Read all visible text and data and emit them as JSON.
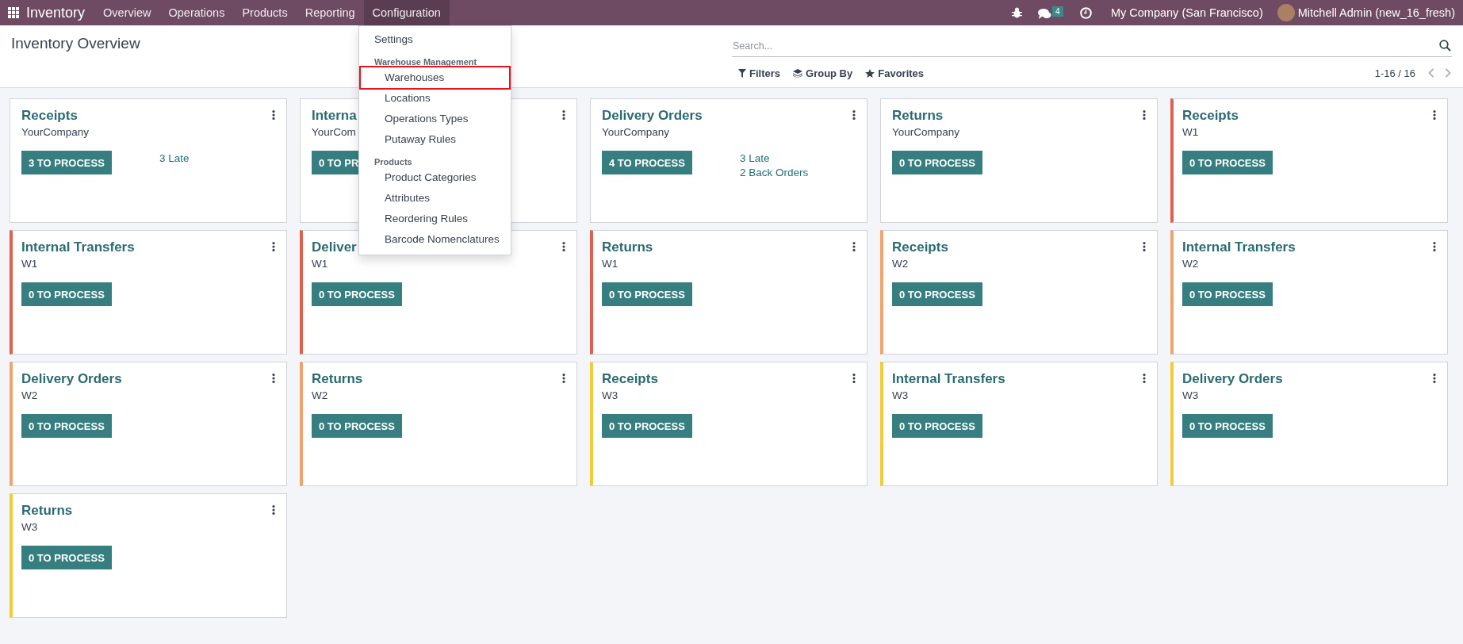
{
  "navbar": {
    "app_name": "Inventory",
    "menus": [
      {
        "label": "Overview",
        "selected": false
      },
      {
        "label": "Operations",
        "selected": false
      },
      {
        "label": "Products",
        "selected": false
      },
      {
        "label": "Reporting",
        "selected": false
      },
      {
        "label": "Configuration",
        "selected": true
      }
    ],
    "messages_badge": "4",
    "company": "My Company (San Francisco)",
    "user": "Mitchell Admin (new_16_fresh)"
  },
  "control_panel": {
    "title": "Inventory Overview",
    "search": {
      "placeholder": "Search..."
    },
    "filters": [
      {
        "kind": "filter",
        "label": "Filters"
      },
      {
        "kind": "group",
        "label": "Group By"
      },
      {
        "kind": "favorite",
        "label": "Favorites"
      }
    ],
    "pager": "1-16 / 16"
  },
  "cards": [
    {
      "title": "Receipts",
      "subtitle": "YourCompany",
      "button": "3 TO PROCESS",
      "links": [
        "3 Late"
      ]
    },
    {
      "title": "Interna",
      "subtitle": "YourCom",
      "button": "0 TO PR"
    },
    {
      "title": "Delivery Orders",
      "subtitle": "YourCompany",
      "button": "4 TO PROCESS",
      "links": [
        "3 Late",
        "2 Back Orders"
      ]
    },
    {
      "title": "Returns",
      "subtitle": "YourCompany",
      "button": "0 TO PROCESS"
    },
    {
      "title": "Receipts",
      "subtitle": "W1",
      "button": "0 TO PROCESS",
      "color": "#e0604f"
    },
    {
      "title": "Internal Transfers",
      "subtitle": "W1",
      "button": "0 TO PROCESS",
      "color": "#e0604f"
    },
    {
      "title": "Deliver",
      "subtitle": "W1",
      "button": "0 TO PROCESS",
      "color": "#e0604f"
    },
    {
      "title": "Returns",
      "subtitle": "W1",
      "button": "0 TO PROCESS",
      "color": "#e0604f"
    },
    {
      "title": "Receipts",
      "subtitle": "W2",
      "button": "0 TO PROCESS",
      "color": "#eda46f"
    },
    {
      "title": "Internal Transfers",
      "subtitle": "W2",
      "button": "0 TO PROCESS",
      "color": "#eda46f"
    },
    {
      "title": "Delivery Orders",
      "subtitle": "W2",
      "button": "0 TO PROCESS",
      "color": "#eda46f"
    },
    {
      "title": "Returns",
      "subtitle": "W2",
      "button": "0 TO PROCESS",
      "color": "#eda46f"
    },
    {
      "title": "Receipts",
      "subtitle": "W3",
      "button": "0 TO PROCESS",
      "color": "#f3cb3a"
    },
    {
      "title": "Internal Transfers",
      "subtitle": "W3",
      "button": "0 TO PROCESS",
      "color": "#f3cb3a"
    },
    {
      "title": "Delivery Orders",
      "subtitle": "W3",
      "button": "0 TO PROCESS",
      "color": "#f3cb3a"
    },
    {
      "title": "Returns",
      "subtitle": "W3",
      "button": "0 TO PROCESS",
      "color": "#f3cb3a"
    }
  ],
  "dropdown": {
    "items": [
      {
        "kind": "item",
        "label": "Settings",
        "highlighted": false
      },
      {
        "kind": "header",
        "label": "Warehouse Management"
      },
      {
        "kind": "subitem",
        "label": "Warehouses",
        "highlighted": true
      },
      {
        "kind": "subitem",
        "label": "Locations",
        "highlighted": false
      },
      {
        "kind": "subitem",
        "label": "Operations Types",
        "highlighted": false
      },
      {
        "kind": "subitem",
        "label": "Putaway Rules",
        "highlighted": false
      },
      {
        "kind": "header",
        "label": "Products"
      },
      {
        "kind": "subitem",
        "label": "Product Categories",
        "highlighted": false
      },
      {
        "kind": "subitem",
        "label": "Attributes",
        "highlighted": false
      },
      {
        "kind": "subitem",
        "label": "Reordering Rules",
        "highlighted": false
      },
      {
        "kind": "subitem",
        "label": "Barcode Nomenclatures",
        "highlighted": false
      }
    ]
  }
}
